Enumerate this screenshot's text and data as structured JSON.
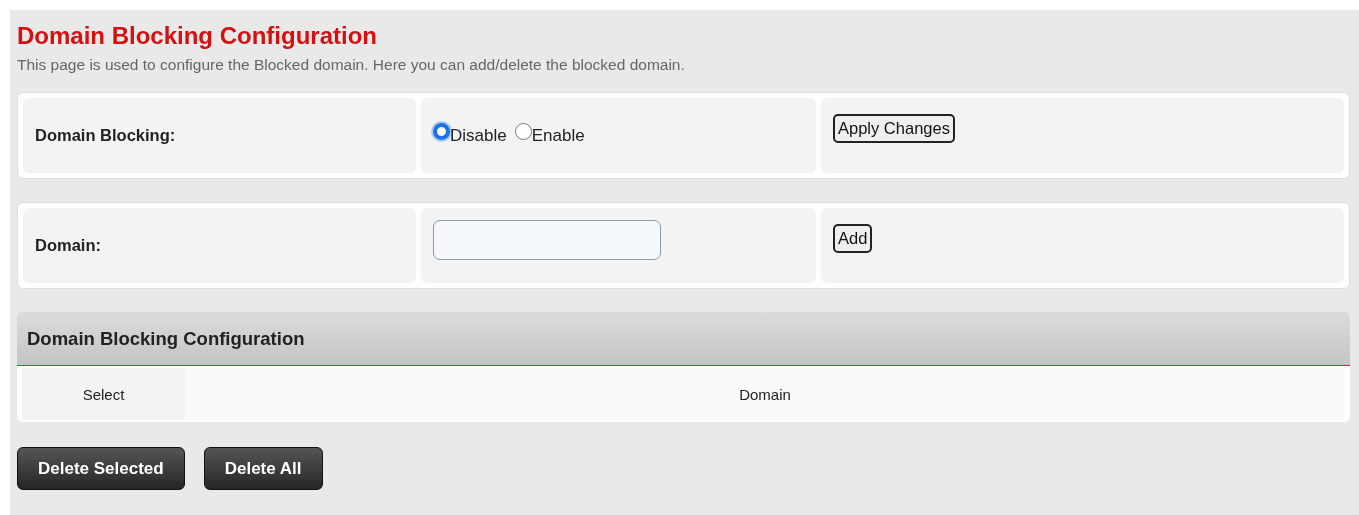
{
  "title": "Domain Blocking Configuration",
  "description": "This page is used to configure the Blocked domain. Here you can add/delete the blocked domain.",
  "settings": [
    {
      "kind": "radio",
      "label": "Domain Blocking:",
      "options": [
        {
          "label": "Disable",
          "selected": true
        },
        {
          "label": "Enable",
          "selected": false
        }
      ],
      "button": "Apply Changes"
    },
    {
      "kind": "input",
      "label": "Domain:",
      "button": "Add"
    }
  ],
  "table": {
    "title": "Domain Blocking Configuration",
    "columns": [
      "Select",
      "Domain"
    ]
  },
  "buttons": [
    "Delete Selected",
    "Delete All"
  ]
}
